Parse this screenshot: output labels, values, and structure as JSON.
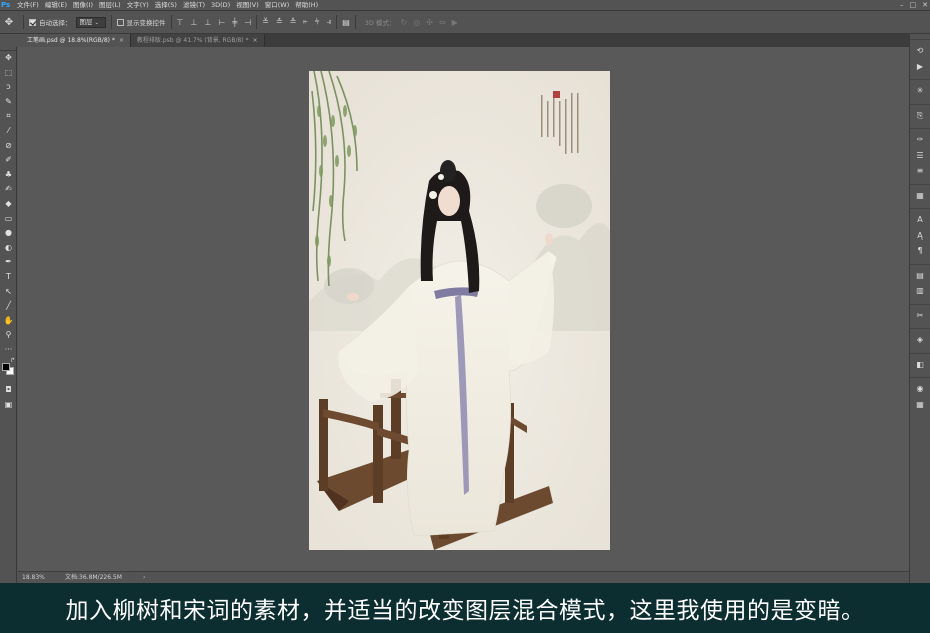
{
  "menubar": {
    "app_logo": "Ps",
    "items": [
      "文件(F)",
      "编辑(E)",
      "图像(I)",
      "图层(L)",
      "文字(Y)",
      "选择(S)",
      "滤镜(T)",
      "3D(D)",
      "视图(V)",
      "窗口(W)",
      "帮助(H)"
    ]
  },
  "options": {
    "tool_icon": "move-tool-icon",
    "auto_select_label": "自动选择：",
    "auto_select_checked": true,
    "auto_select_value": "图层",
    "show_transform_label": "显示变换控件",
    "show_transform_checked": false,
    "mode_3d_label": "3D 模式："
  },
  "tabs": [
    {
      "label": "工笔画.psd @ 18.8%(RGB/8) *",
      "active": true
    },
    {
      "label": "教程排版.psb @ 41.7% (背景, RGB/8) *",
      "active": false
    }
  ],
  "toolbar": {
    "tools": [
      "move-tool-icon",
      "marquee-tool-icon",
      "lasso-tool-icon",
      "quick-select-tool-icon",
      "crop-tool-icon",
      "eyedropper-tool-icon",
      "spot-heal-tool-icon",
      "brush-tool-icon",
      "clone-stamp-tool-icon",
      "history-brush-tool-icon",
      "eraser-tool-icon",
      "gradient-tool-icon",
      "blur-tool-icon",
      "dodge-tool-icon",
      "pen-tool-icon",
      "type-tool-icon",
      "path-select-tool-icon",
      "line-tool-icon",
      "hand-tool-icon",
      "zoom-tool-icon",
      "more-tools-icon"
    ]
  },
  "status": {
    "zoom": "18.83%",
    "doc_info": "文档:36.8M/226.5M"
  },
  "colors": {
    "foreground": "#000000",
    "background": "#ffffff",
    "caption_bg": "#0c2e30",
    "ui_bg": "#535353"
  },
  "caption": {
    "text": "加入柳树和宋词的素材，并适当的改变图层混合模式，这里我使用的是变暗。"
  }
}
